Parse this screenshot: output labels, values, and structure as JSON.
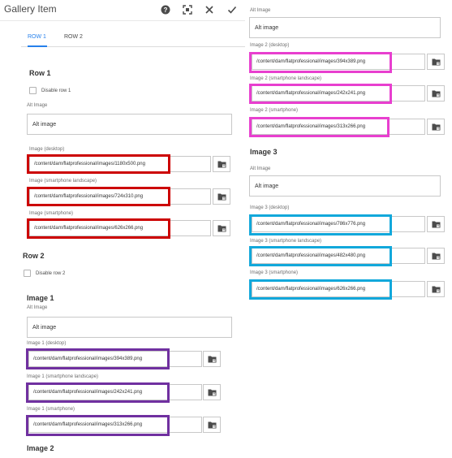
{
  "dialog": {
    "title": "Gallery Item",
    "tabs": [
      {
        "label": "ROW 1",
        "active": true
      },
      {
        "label": "ROW 2",
        "active": false
      }
    ]
  },
  "row1": {
    "heading": "Row 1",
    "disable_label": "Disable row 1",
    "alt_label": "Alt Image",
    "alt_value": "Alt image",
    "desktop_label": "Image (desktop)",
    "desktop_value": "/content/dam/flatprofessional/images/1180x500.png",
    "landscape_label": "Image (smartphone landscape)",
    "landscape_value": "/content/dam/flatprofessional/images/724x310.png",
    "smartphone_label": "Image (smartphone)",
    "smartphone_value": "/content/dam/flatprofessional/images/626x266.png"
  },
  "row2": {
    "heading": "Row 2",
    "disable_label": "Disable row 2",
    "image1": {
      "heading": "Image 1",
      "alt_label": "Alt Image",
      "alt_value": "Alt image",
      "desktop_label": "Image 1 (desktop)",
      "desktop_value": "/content/dam/flatprofessional/images/394x389.png",
      "landscape_label": "Image 1 (smartphone landscape)",
      "landscape_value": "/content/dam/flatprofessional/images/242x241.png",
      "smartphone_label": "Image 1 (smartphone)",
      "smartphone_value": "/content/dam/flatprofessional/images/313x266.png"
    },
    "image2_heading": "Image 2"
  },
  "right": {
    "image2": {
      "alt_label": "Alt Image",
      "alt_value": "Alt image",
      "desktop_label": "Image 2 (desktop)",
      "desktop_value": "/content/dam/flatprofessional/images/394x389.png",
      "landscape_label": "Image 2 (smartphone landscape)",
      "landscape_value": "/content/dam/flatprofessional/images/242x241.png",
      "smartphone_label": "Image 2 (smartphone)",
      "smartphone_value": "/content/dam/flatprofessional/images/313x266.png"
    },
    "image3": {
      "heading": "Image 3",
      "alt_label": "Alt Image",
      "alt_value": "Alt image",
      "desktop_label": "Image 3 (desktop)",
      "desktop_value": "/content/dam/flatprofessional/images/786x776.png",
      "landscape_label": "Image 3 (smartphone landscape)",
      "landscape_value": "/content/dam/flatprofessional/images/482x480.png",
      "smartphone_label": "Image 3 (smartphone)",
      "smartphone_value": "/content/dam/flatprofessional/images/626x266.png"
    }
  },
  "colors": {
    "accent": "#2680eb",
    "highlight_row1": "#cc0000",
    "highlight_image1": "#7030a0",
    "highlight_image2": "#e83fcf",
    "highlight_image3": "#12a8db"
  },
  "icons": [
    "help-icon",
    "fullscreen-icon",
    "close-icon",
    "done-icon",
    "browse-icon"
  ]
}
